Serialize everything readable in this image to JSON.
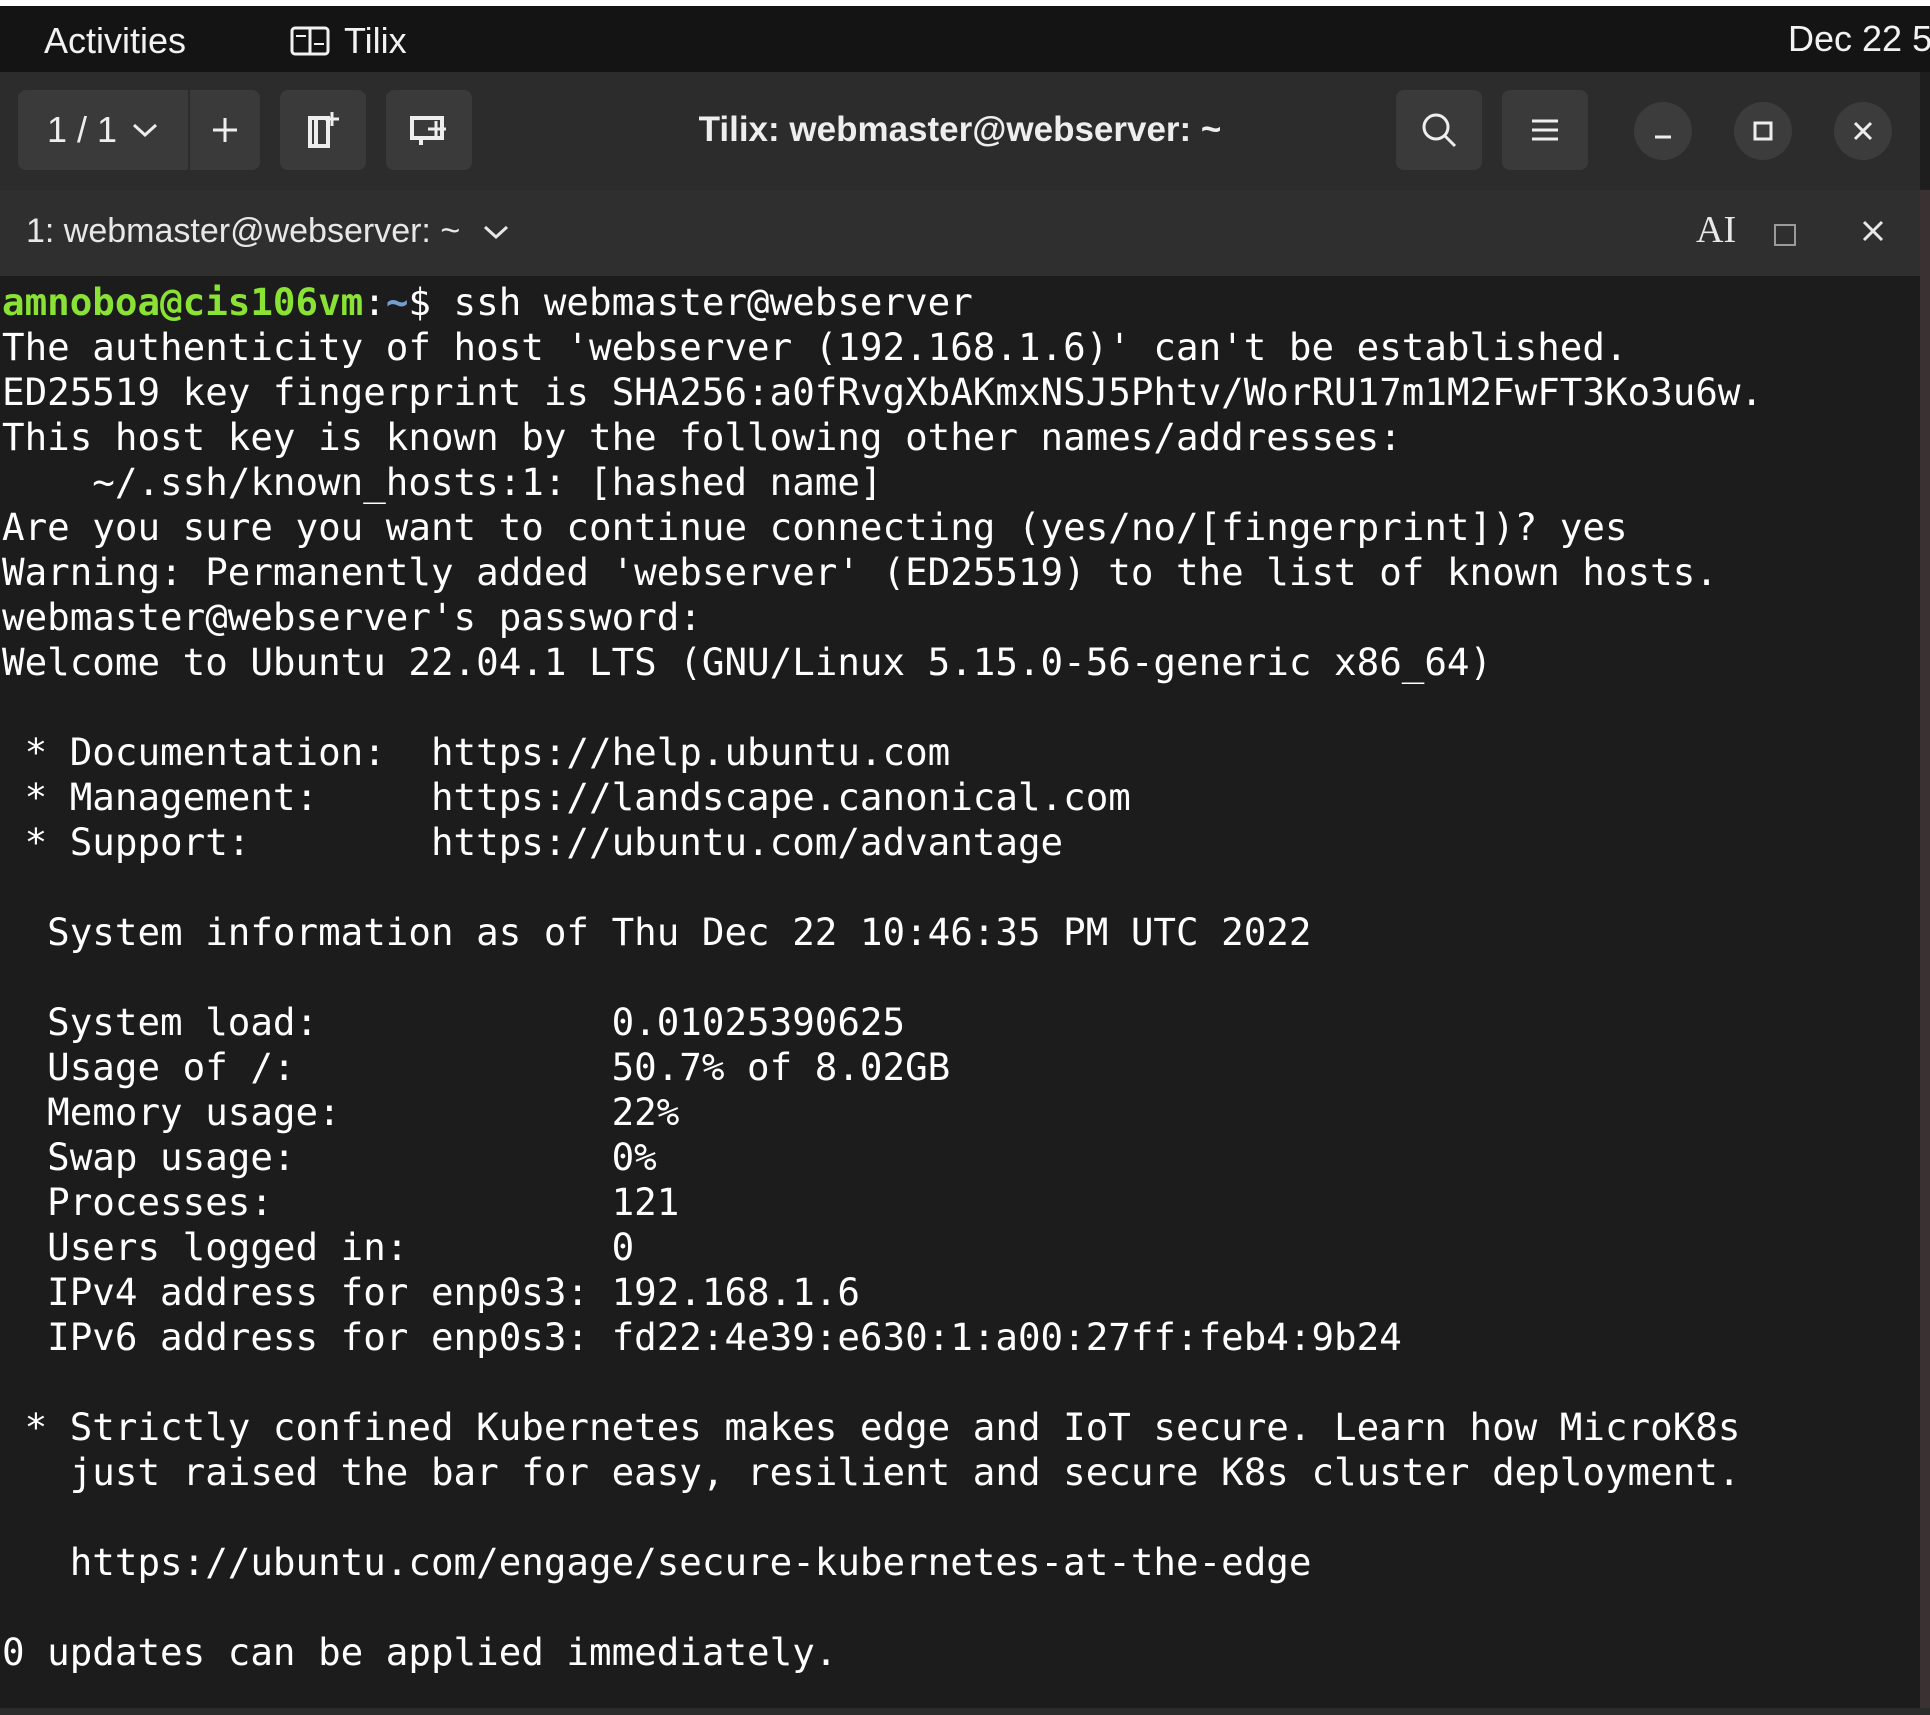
{
  "topbar": {
    "activities": "Activities",
    "app_name": "Tilix",
    "clock": "Dec 22 5"
  },
  "headerbar": {
    "session_counter": "1 / 1",
    "window_title": "Tilix: webmaster@webserver: ~"
  },
  "terminal_titlebar": {
    "title": "1: webmaster@webserver: ~",
    "readonly_label": "AI"
  },
  "terminal": {
    "prompt": {
      "user_host": "amnoboa@cis106vm",
      "path": "~",
      "symbol": "$",
      "command": " ssh webmaster@webserver"
    },
    "lines": [
      "The authenticity of host 'webserver (192.168.1.6)' can't be established.",
      "ED25519 key fingerprint is SHA256:a0fRvgXbAKmxNSJ5Phtv/WorRU17m1M2FwFT3Ko3u6w.",
      "This host key is known by the following other names/addresses:",
      "    ~/.ssh/known_hosts:1: [hashed name]",
      "Are you sure you want to continue connecting (yes/no/[fingerprint])? yes",
      "Warning: Permanently added 'webserver' (ED25519) to the list of known hosts.",
      "webmaster@webserver's password:",
      "Welcome to Ubuntu 22.04.1 LTS (GNU/Linux 5.15.0-56-generic x86_64)",
      "",
      " * Documentation:  https://help.ubuntu.com",
      " * Management:     https://landscape.canonical.com",
      " * Support:        https://ubuntu.com/advantage",
      "",
      "  System information as of Thu Dec 22 10:46:35 PM UTC 2022",
      "",
      "  System load:             0.01025390625",
      "  Usage of /:              50.7% of 8.02GB",
      "  Memory usage:            22%",
      "  Swap usage:              0%",
      "  Processes:               121",
      "  Users logged in:         0",
      "  IPv4 address for enp0s3: 192.168.1.6",
      "  IPv6 address for enp0s3: fd22:4e39:e630:1:a00:27ff:feb4:9b24",
      "",
      " * Strictly confined Kubernetes makes edge and IoT secure. Learn how MicroK8s",
      "   just raised the bar for easy, resilient and secure K8s cluster deployment.",
      "",
      "   https://ubuntu.com/engage/secure-kubernetes-at-the-edge",
      "",
      "0 updates can be applied immediately."
    ]
  },
  "icons": {
    "app_icon": "terminal-app-icon",
    "chevron": "chevron-down-icon",
    "add": "plus-icon",
    "sidebar": "sidebar-icon",
    "add_terminal": "add-terminal-icon",
    "search": "search-icon",
    "menu": "hamburger-icon",
    "minimize": "minimize-icon",
    "maximize": "maximize-icon",
    "close": "close-icon"
  },
  "colors": {
    "prompt_user": "#8ae234",
    "prompt_path": "#729fcf",
    "terminal_bg": "#1c1c1c",
    "headerbar_bg": "#2c2c2c"
  }
}
